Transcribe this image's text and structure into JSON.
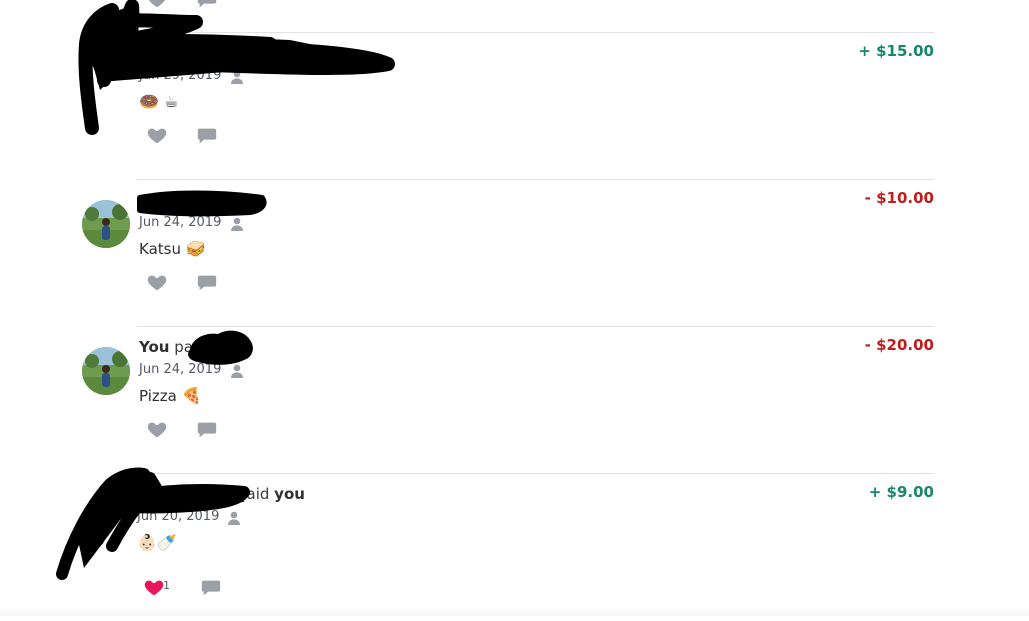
{
  "stories": [
    {
      "title": {
        "pre": "",
        "actor": "",
        "verb": "",
        "target": ""
      },
      "amount": "+ $15.00",
      "amount_sign": "pos",
      "date": "Jun 29, 2019",
      "note_text": "",
      "note_emoji": "🍩 ☕",
      "likes": ""
    },
    {
      "title": {
        "pre": "",
        "actor": "",
        "verb": "",
        "target": ""
      },
      "amount": "- $10.00",
      "amount_sign": "neg",
      "date": "Jun 24, 2019",
      "note_text": "Katsu",
      "note_emoji": "🥪",
      "likes": ""
    },
    {
      "title": {
        "pre": "",
        "actor": "You",
        "verb": " pa",
        "target": ""
      },
      "amount": "- $20.00",
      "amount_sign": "neg",
      "date": "Jun 24, 2019",
      "note_text": "Pizza",
      "note_emoji": "🍕",
      "likes": ""
    },
    {
      "title": {
        "pre": "",
        "actor": "",
        "verb": "paid ",
        "target": "you"
      },
      "amount": "+ $9.00",
      "amount_sign": "pos",
      "date": "Jun 20, 2019",
      "note_text": "",
      "note_emoji": "👶🏻🍼",
      "likes": "1"
    }
  ],
  "colors": {
    "positive": "#16876b",
    "negative": "#c01c1c",
    "icon_gray": "#9aa0a6",
    "liked_pink": "#e8175d",
    "redaction": "#000000"
  },
  "icons": {
    "privacy": "person-icon",
    "like": "heart-icon",
    "comment": "comment-bubble-icon"
  }
}
